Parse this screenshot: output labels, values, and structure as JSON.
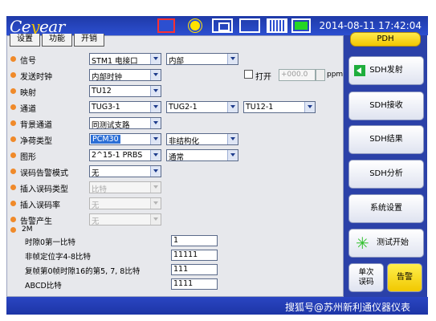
{
  "header": {
    "logo_prefix": "Ce",
    "logo_o": "y",
    "logo_suffix": "ear",
    "datetime": "2014-08-11 17:42:04"
  },
  "tabs": [
    "设置",
    "功能",
    "开销"
  ],
  "rows": [
    {
      "label": "信号",
      "v1": "STM1 电接口",
      "v2": "内部"
    },
    {
      "label": "发送时钟",
      "v1": "内部时钟",
      "check_label": "打开",
      "freq": "+000.0",
      "unit": "ppm"
    },
    {
      "label": "映射",
      "v1": "TU12"
    },
    {
      "label": "通道",
      "v1": "TUG3-1",
      "v2": "TUG2-1",
      "v3": "TU12-1"
    },
    {
      "label": "背景通道",
      "v1": "同测试支路"
    },
    {
      "label": "净荷类型",
      "v1": "PCM30",
      "v2": "非结构化"
    },
    {
      "label": "图形",
      "v1": "2^15-1 PRBS",
      "v2": "通常"
    },
    {
      "label": "误码告警模式",
      "v1": "无"
    },
    {
      "label": "插入误码类型",
      "v1": "比特"
    },
    {
      "label": "插入误码率",
      "v1": "无"
    },
    {
      "label": "告警产生",
      "v1": "无"
    }
  ],
  "box2m": {
    "title": "2M",
    "rows": [
      {
        "label": "时隙0第一比特",
        "value": "1"
      },
      {
        "label": "非帧定位字4-8比特",
        "value": "11111"
      },
      {
        "label": "复帧第0帧时隙16的第5, 7, 8比特",
        "value": "111"
      },
      {
        "label": "ABCD比特",
        "value": "1111"
      }
    ]
  },
  "side": {
    "pdh": "PDH",
    "buttons": [
      "SDH发射",
      "SDH接收",
      "SDH结果",
      "SDH分析",
      "系统设置",
      "测试开始"
    ],
    "single": [
      "单次",
      "误码"
    ],
    "alarm": "告警"
  },
  "watermark": "搜狐号@苏州新利通仪器仪表",
  "colors": {
    "bar": "#2b41a8",
    "accent_yellow": "#f2c600",
    "bullet": "#f08a2a"
  }
}
